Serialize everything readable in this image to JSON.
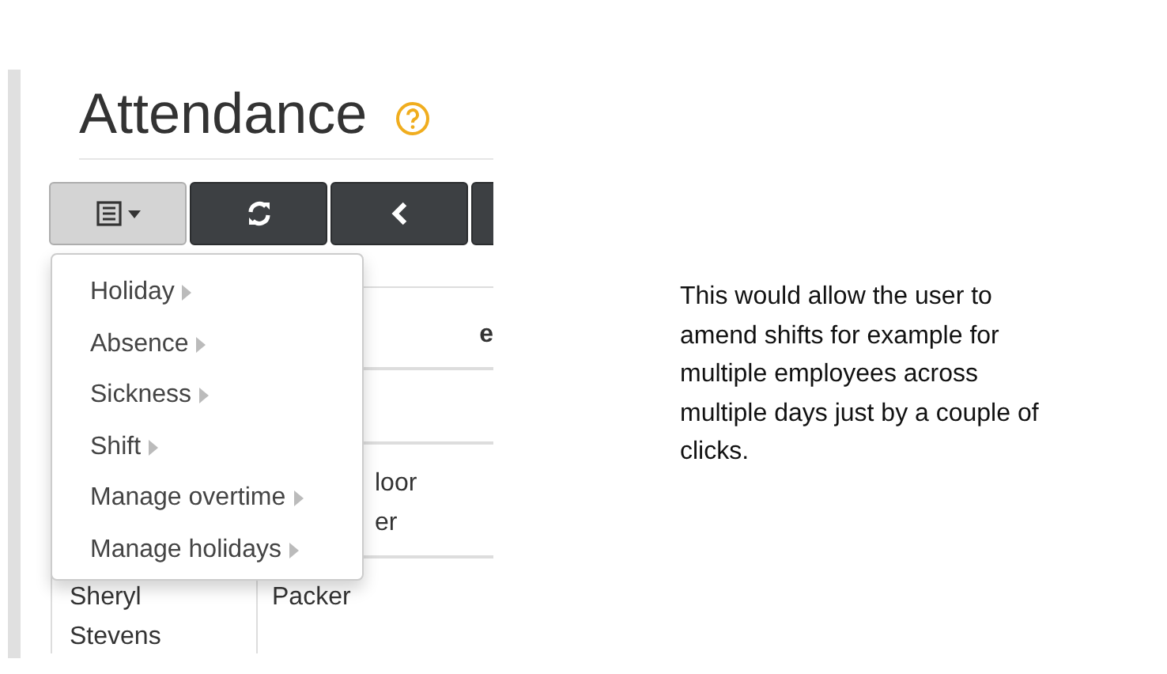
{
  "page": {
    "title": "Attendance"
  },
  "toolbar": [
    {
      "kind": "list-dropdown",
      "expanded": true
    },
    {
      "kind": "refresh"
    },
    {
      "kind": "back"
    },
    {
      "kind": "blank"
    }
  ],
  "menu": {
    "items": [
      {
        "label": "Holiday",
        "submenu": true
      },
      {
        "label": "Absence",
        "submenu": true
      },
      {
        "label": "Sickness",
        "submenu": true
      },
      {
        "label": "Shift",
        "submenu": true
      },
      {
        "label": "Manage overtime",
        "submenu": true
      },
      {
        "label": "Manage holidays",
        "submenu": true
      }
    ]
  },
  "table": {
    "columns": [
      "",
      "e"
    ],
    "rows": [
      {
        "cells": [
          [],
          []
        ]
      },
      {
        "cells": [
          [],
          [
            "loor",
            "er"
          ]
        ]
      },
      {
        "cells": [
          [
            "Sheryl",
            "Stevens"
          ],
          [
            "Packer"
          ]
        ]
      }
    ]
  },
  "note": {
    "text": "This would allow the user to amend shifts for example for multiple employees across multiple days just by a couple of clicks."
  }
}
